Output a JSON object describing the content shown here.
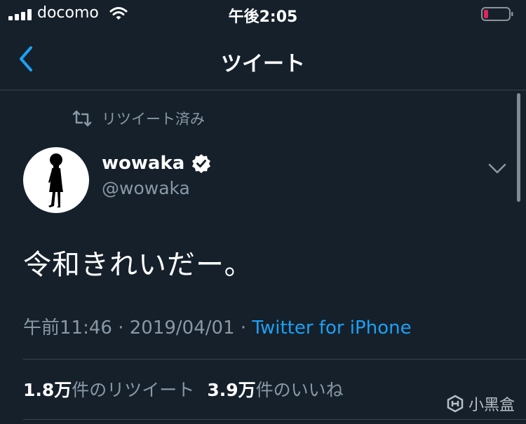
{
  "status_bar": {
    "carrier": "docomo",
    "time": "午後2:05"
  },
  "nav": {
    "title": "ツイート"
  },
  "retweet": {
    "label": "リツイート済み"
  },
  "user": {
    "name": "wowaka",
    "handle": "@wowaka"
  },
  "tweet": {
    "text": "令和きれいだー。",
    "time": "午前11:46",
    "separator1": "·",
    "date": "2019/04/01",
    "separator2": "·",
    "source": "Twitter for iPhone"
  },
  "stats": {
    "retweets_count": "1.8万",
    "retweets_label": "件のリツイート",
    "likes_count": "3.9万",
    "likes_label": "件のいいね"
  },
  "watermark": {
    "text": "小黑盒"
  },
  "colors": {
    "background": "#15202b",
    "accent": "#1da1f2",
    "muted": "#8899a6",
    "battery_low": "#e0245e"
  },
  "icons": [
    "signal-icon",
    "wifi-icon",
    "battery-icon",
    "back-chevron-icon",
    "retweet-icon",
    "verified-badge-icon",
    "chevron-down-icon",
    "watermark-logo-icon"
  ]
}
